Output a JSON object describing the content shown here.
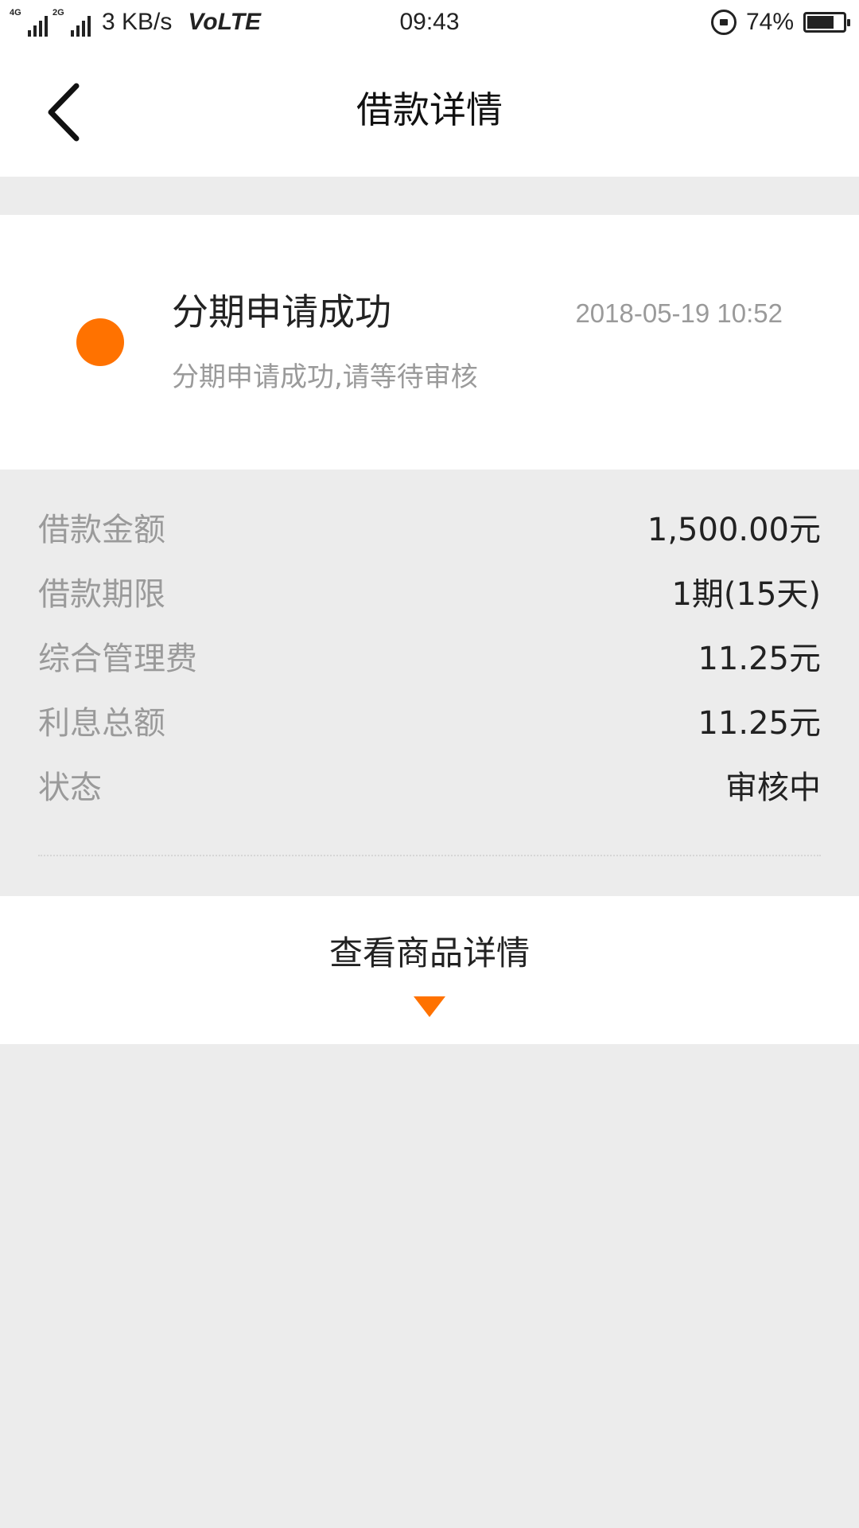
{
  "status_bar": {
    "net_1_tag": "4G",
    "net_2_tag": "2G",
    "speed": "3 KB/s",
    "volte": "VoLTE",
    "time": "09:43",
    "battery_percent": "74%",
    "battery_level": 0.74,
    "icons": [
      "signal-icon",
      "signal-icon",
      "rotation-lock-icon",
      "battery-icon"
    ]
  },
  "header": {
    "title": "借款详情",
    "back_icon": "chevron-left-icon"
  },
  "status": {
    "title": "分期申请成功",
    "time": "2018-05-19 10:52",
    "description": "分期申请成功,请等待审核",
    "dot_color": "#ff7200"
  },
  "details": [
    {
      "label": "借款金额",
      "value": "1,500.00元"
    },
    {
      "label": "借款期限",
      "value": "1期(15天)"
    },
    {
      "label": "综合管理费",
      "value": "11.25元"
    },
    {
      "label": "利息总额",
      "value": "11.25元"
    },
    {
      "label": "状态",
      "value": "审核中"
    }
  ],
  "product": {
    "label": "查看商品详情",
    "arrow_icon": "triangle-down-icon",
    "accent": "#ff7200"
  },
  "colors": {
    "accent": "#ff7200",
    "background": "#ececec",
    "muted_text": "#9a9a9a"
  }
}
